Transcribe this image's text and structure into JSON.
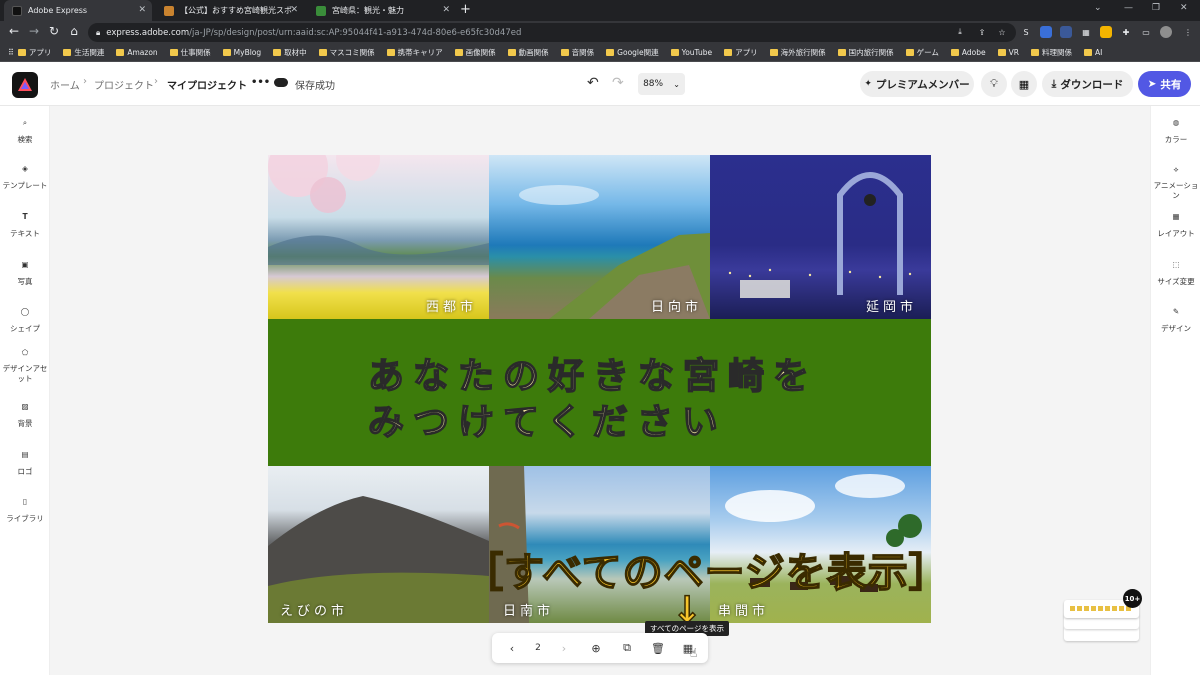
{
  "browser": {
    "tabs": [
      {
        "title": "Adobe Express"
      },
      {
        "title": "【公式】おすすめ宮崎観光スポット／"
      },
      {
        "title": "宮崎県：観光・魅力"
      }
    ],
    "url_domain": "express.adobe.com",
    "url_path": "/ja-JP/sp/design/post/urn:aaid:sc:AP:95044f41-a913-474d-80e6-e65fc30d47ed",
    "bookmarks": [
      "アプリ",
      "生活関連",
      "Amazon",
      "仕事関係",
      "MyBlog",
      "取材中",
      "マスコミ関係",
      "携帯キャリア",
      "画像関係",
      "動画関係",
      "音関係",
      "Google関連",
      "YouTube",
      "アプリ",
      "海外旅行関係",
      "国内旅行関係",
      "ゲーム",
      "Adobe",
      "VR",
      "料理関係",
      "AI"
    ]
  },
  "header": {
    "breadcrumb": [
      "ホーム",
      "プロジェクト",
      "マイプロジェクト"
    ],
    "more": "•••",
    "save_status": "保存成功",
    "zoom": "88%",
    "premium_label": "プレミアムメンバー",
    "download_label": "ダウンロード",
    "share_label": "共有"
  },
  "left_rail": [
    "検索",
    "テンプレート",
    "テキスト",
    "写真",
    "シェイプ",
    "デザインアセット",
    "背景",
    "ロゴ",
    "ライブラリ"
  ],
  "right_rail": [
    "カラー",
    "アニメーション",
    "レイアウト",
    "サイズ変更",
    "デザイン"
  ],
  "design": {
    "headline_line1": "あなたの好きな宮崎を",
    "headline_line2": "みつけてください",
    "photos_top": [
      "西都市",
      "日向市",
      "延岡市"
    ],
    "photos_bottom": [
      "えびの市",
      "日南市",
      "串間市"
    ],
    "band_color": "#3d7b0b"
  },
  "overlay": {
    "annotation": "［すべてのページを表示］",
    "arrow": "↓",
    "tooltip": "すべてのページを表示"
  },
  "pagebar": {
    "page_number": "2"
  },
  "thumbs_badge": "10+"
}
